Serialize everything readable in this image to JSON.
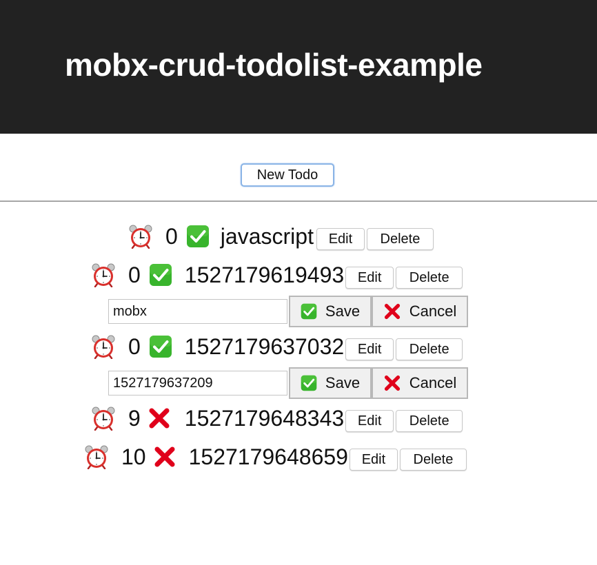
{
  "header": {
    "title": "mobx-crud-todolist-example"
  },
  "toolbar": {
    "new_todo_label": "New Todo"
  },
  "todos": [
    {
      "count": "0",
      "done": true,
      "text": "javascript",
      "edit_label": "Edit",
      "delete_label": "Delete"
    },
    {
      "count": "0",
      "done": true,
      "text": "1527179619493",
      "edit_label": "Edit",
      "delete_label": "Delete"
    },
    {
      "count": "0",
      "done": true,
      "text": "1527179637032",
      "edit_label": "Edit",
      "delete_label": "Delete"
    },
    {
      "count": "9",
      "done": false,
      "text": "1527179648343",
      "edit_label": "Edit",
      "delete_label": "Delete"
    },
    {
      "count": "10",
      "done": false,
      "text": "1527179648659",
      "edit_label": "Edit",
      "delete_label": "Delete"
    }
  ],
  "editors": [
    {
      "value": "mobx",
      "save_label": "Save",
      "cancel_label": "Cancel"
    },
    {
      "value": "1527179637209",
      "save_label": "Save",
      "cancel_label": "Cancel"
    }
  ],
  "icons": {
    "alarm": "alarm-clock-icon",
    "done": "check-mark-icon",
    "not_done": "cross-mark-icon"
  },
  "colors": {
    "header_bg": "#222222",
    "check_green": "#38b42c",
    "cross_red": "#e0001b",
    "alarm_red": "#d9302c"
  }
}
